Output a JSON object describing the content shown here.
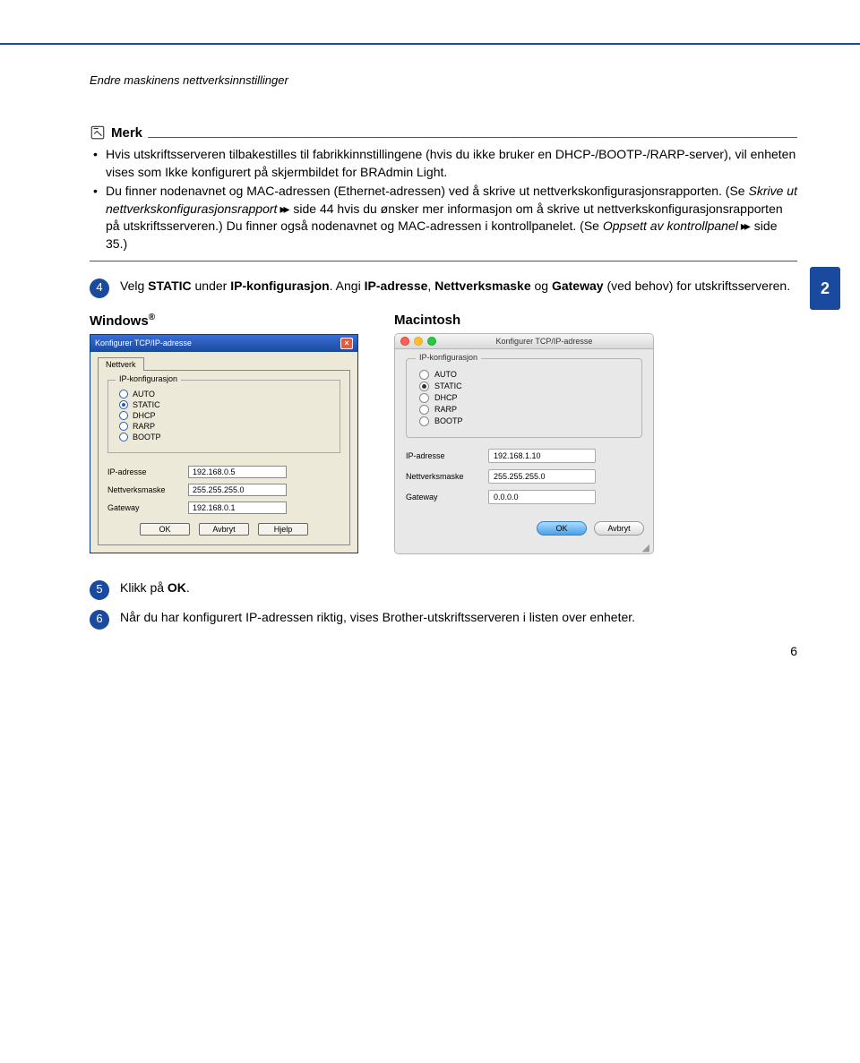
{
  "section_header": "Endre maskinens nettverksinnstillinger",
  "chapter_number": "2",
  "page_number": "6",
  "note": {
    "title": "Merk",
    "bullet1": "Hvis utskriftsserveren tilbakestilles til fabrikkinnstillingene (hvis du ikke bruker en DHCP-/BOOTP-/RARP-server), vil enheten vises som Ikke konfigurert på skjermbildet for BRAdmin Light.",
    "bullet2_p1": "Du finner nodenavnet og MAC-adressen (Ethernet-adressen) ved å skrive ut nettverkskonfigurasjonsrapporten. (Se ",
    "bullet2_ref1": "Skrive ut nettverkskonfigurasjonsrapport",
    "bullet2_p2": " side 44 hvis du ønsker mer informasjon om å skrive ut nettverkskonfigurasjonsrapporten på utskriftsserveren.) Du finner også nodenavnet og MAC-adressen i kontrollpanelet. (Se ",
    "bullet2_ref2": "Oppsett av kontrollpanel",
    "bullet2_p3": " side 35.)"
  },
  "steps": {
    "s4_num": "4",
    "s4_p1": "Velg ",
    "s4_b1": "STATIC",
    "s4_p2": " under ",
    "s4_b2": "IP-konfigurasjon",
    "s4_p3": ". Angi ",
    "s4_b3": "IP-adresse",
    "s4_p4": ", ",
    "s4_b4": "Nettverksmaske",
    "s4_p5": " og ",
    "s4_b5": "Gateway",
    "s4_p6": " (ved behov) for utskriftsserveren.",
    "s5_num": "5",
    "s5_p1": "Klikk på ",
    "s5_b1": "OK",
    "s5_p2": ".",
    "s6_num": "6",
    "s6_text": "Når du har konfigurert IP-adressen riktig, vises Brother-utskriftsserveren i listen over enheter."
  },
  "os": {
    "windows": "Windows",
    "reg": "®",
    "mac": "Macintosh"
  },
  "win": {
    "title": "Konfigurer TCP/IP-adresse",
    "tab": "Nettverk",
    "group": "IP-konfigurasjon",
    "opt_auto": "AUTO",
    "opt_static": "STATIC",
    "opt_dhcp": "DHCP",
    "opt_rarp": "RARP",
    "opt_bootp": "BOOTP",
    "ip_label": "IP-adresse",
    "ip_value": "192.168.0.5",
    "mask_label": "Nettverksmaske",
    "mask_value": "255.255.255.0",
    "gw_label": "Gateway",
    "gw_value": "192.168.0.1",
    "btn_ok": "OK",
    "btn_cancel": "Avbryt",
    "btn_help": "Hjelp"
  },
  "mac": {
    "title": "Konfigurer TCP/IP-adresse",
    "group": "IP-konfigurasjon",
    "opt_auto": "AUTO",
    "opt_static": "STATIC",
    "opt_dhcp": "DHCP",
    "opt_rarp": "RARP",
    "opt_bootp": "BOOTP",
    "ip_label": "IP-adresse",
    "ip_value": "192.168.1.10",
    "mask_label": "Nettverksmaske",
    "mask_value": "255.255.255.0",
    "gw_label": "Gateway",
    "gw_value": "0.0.0.0",
    "btn_ok": "OK",
    "btn_cancel": "Avbryt"
  }
}
